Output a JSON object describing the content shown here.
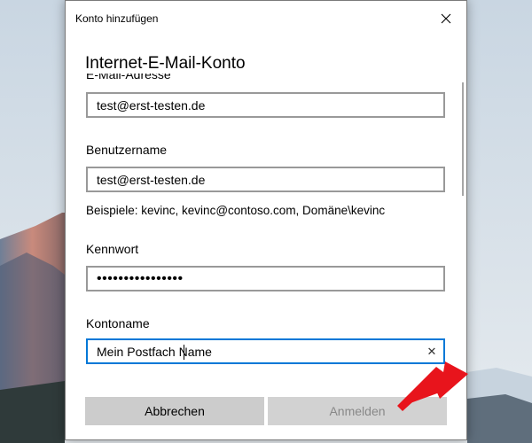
{
  "window": {
    "title": "Konto hinzufügen"
  },
  "form": {
    "heading": "Internet-E-Mail-Konto",
    "email": {
      "label": "E-Mail-Adresse",
      "value": "test@erst-testen.de"
    },
    "username": {
      "label": "Benutzername",
      "value": "test@erst-testen.de",
      "hint": "Beispiele: kevinc, kevinc@contoso.com, Domäne\\kevinc"
    },
    "password": {
      "label": "Kennwort",
      "value": "••••••••••••••••"
    },
    "account_name": {
      "label": "Kontoname",
      "value": "Mein Postfach Name"
    }
  },
  "buttons": {
    "cancel": "Abbrechen",
    "login": "Anmelden"
  },
  "colors": {
    "focus": "#0078d7",
    "arrow": "#e8141c",
    "button_bg": "#cccccc"
  }
}
